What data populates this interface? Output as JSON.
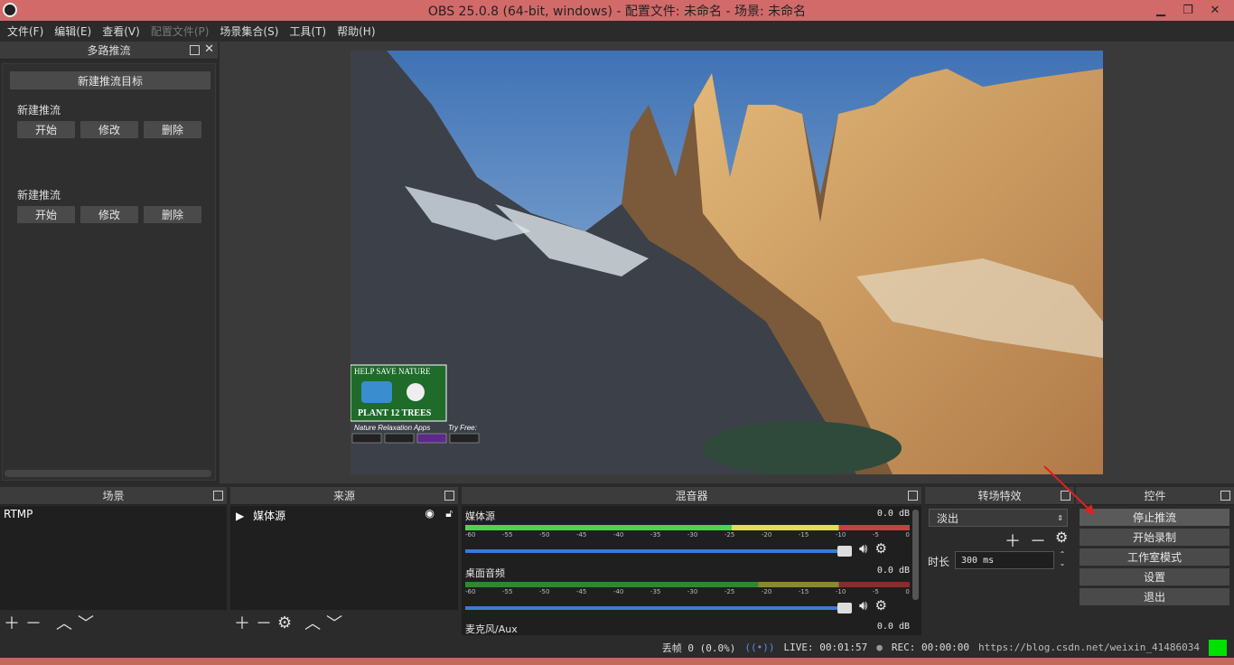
{
  "window": {
    "title": "OBS 25.0.8 (64-bit, windows) - 配置文件: 未命名 - 场景: 未命名"
  },
  "menu": [
    "文件(F)",
    "编辑(E)",
    "查看(V)",
    "配置文件(P)",
    "场景集合(S)",
    "工具(T)",
    "帮助(H)"
  ],
  "multistream": {
    "title": "多路推流",
    "new_target": "新建推流目标",
    "groups": [
      {
        "label": "新建推流",
        "start": "开始",
        "edit": "修改",
        "delete": "删除"
      },
      {
        "label": "新建推流",
        "start": "开始",
        "edit": "修改",
        "delete": "删除"
      }
    ]
  },
  "preview": {
    "overlay_line1": "HELP SAVE NATURE",
    "overlay_line2": "PLANT 12 TREES",
    "overlay_line3": "Nature Relaxation Apps",
    "overlay_line4": "Try Free:"
  },
  "scenes": {
    "title": "场景",
    "items": [
      "RTMP"
    ]
  },
  "sources": {
    "title": "来源",
    "items": [
      "媒体源"
    ]
  },
  "mixer": {
    "title": "混音器",
    "channels": [
      {
        "name": "媒体源",
        "db": "0.0 dB"
      },
      {
        "name": "桌面音频",
        "db": "0.0 dB"
      },
      {
        "name": "麦克风/Aux",
        "db": "0.0 dB"
      }
    ],
    "ticks": [
      "-60",
      "-55",
      "-50",
      "-45",
      "-40",
      "-35",
      "-30",
      "-25",
      "-20",
      "-15",
      "-10",
      "-5",
      "0"
    ]
  },
  "transitions": {
    "title": "转场特效",
    "selected": "淡出",
    "duration_label": "时长",
    "duration": "300 ms"
  },
  "controls": {
    "title": "控件",
    "buttons": [
      "停止推流",
      "开始录制",
      "工作室模式",
      "设置",
      "退出"
    ]
  },
  "status": {
    "dropped": "丢帧 0 (0.0%)",
    "live": "LIVE: 00:01:57",
    "rec": "REC: 00:00:00",
    "watermark": "https://blog.csdn.net/weixin_41486034"
  }
}
